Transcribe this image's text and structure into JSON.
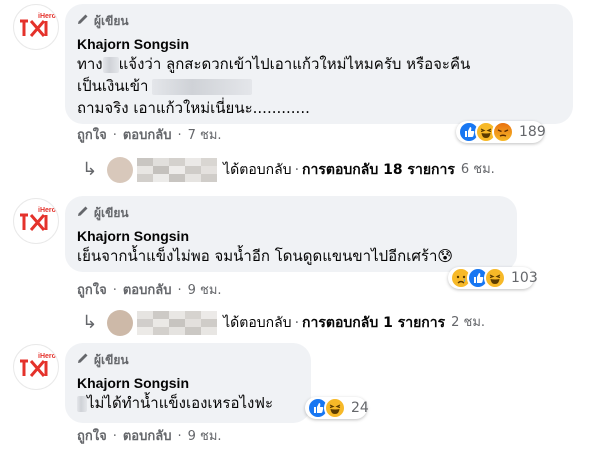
{
  "comments": [
    {
      "author_tag": "ผู้เขียน",
      "author_name": "Khajorn Songsin",
      "avatar_text": "iHero",
      "line1_pre": "ทาง",
      "line1_post": "แจ้งว่า ลูกสะดวกเข้าไปเอาแก้วใหม่ไหมครับ หรือจะคืน",
      "line2": "เป็นเงินเข้า",
      "line3": "ถามจริง เอาแก้วใหม่เนี่ยนะ............",
      "reaction_count": "189",
      "reactions": [
        "like-icon",
        "haha-icon",
        "angry-icon"
      ],
      "like": "ถูกใจ",
      "reply": "ตอบกลับ",
      "time": "7 ชม.",
      "replies": {
        "text": "ได้ตอบกลับ",
        "label": "การตอบกลับ",
        "count": "18 รายการ",
        "time": "6 ชม."
      }
    },
    {
      "author_tag": "ผู้เขียน",
      "author_name": "Khajorn Songsin",
      "avatar_text": "iHero",
      "line1": "เย็นจากน้ำแข็งไม่พอ จมน้ำอีก โดนดูดแขนขาไปอีกเศร้า😰",
      "reaction_count": "103",
      "reactions": [
        "sad-icon",
        "like-icon",
        "haha-icon"
      ],
      "like": "ถูกใจ",
      "reply": "ตอบกลับ",
      "time": "9 ชม.",
      "replies": {
        "text": "ได้ตอบกลับ",
        "label": "การตอบกลับ",
        "count": "1 รายการ",
        "time": "2 ชม."
      }
    },
    {
      "author_tag": "ผู้เขียน",
      "author_name": "Khajorn Songsin",
      "avatar_text": "iHero",
      "line1": "ไม่ได้ทำน้ำแข็งเองเหรอไงฟะ",
      "reaction_count": "24",
      "reactions": [
        "like-icon",
        "haha-icon"
      ],
      "like": "ถูกใจ",
      "reply": "ตอบกลับ",
      "time": "9 ชม."
    }
  ],
  "separator": "·",
  "colors": {
    "bubble": "#f0f2f5",
    "brand_red": "#e4322b",
    "like_blue": "#1877f2",
    "haha_yellow": "#f7b928",
    "angry_orange": "#e9710f",
    "meta_gray": "#65676b"
  }
}
